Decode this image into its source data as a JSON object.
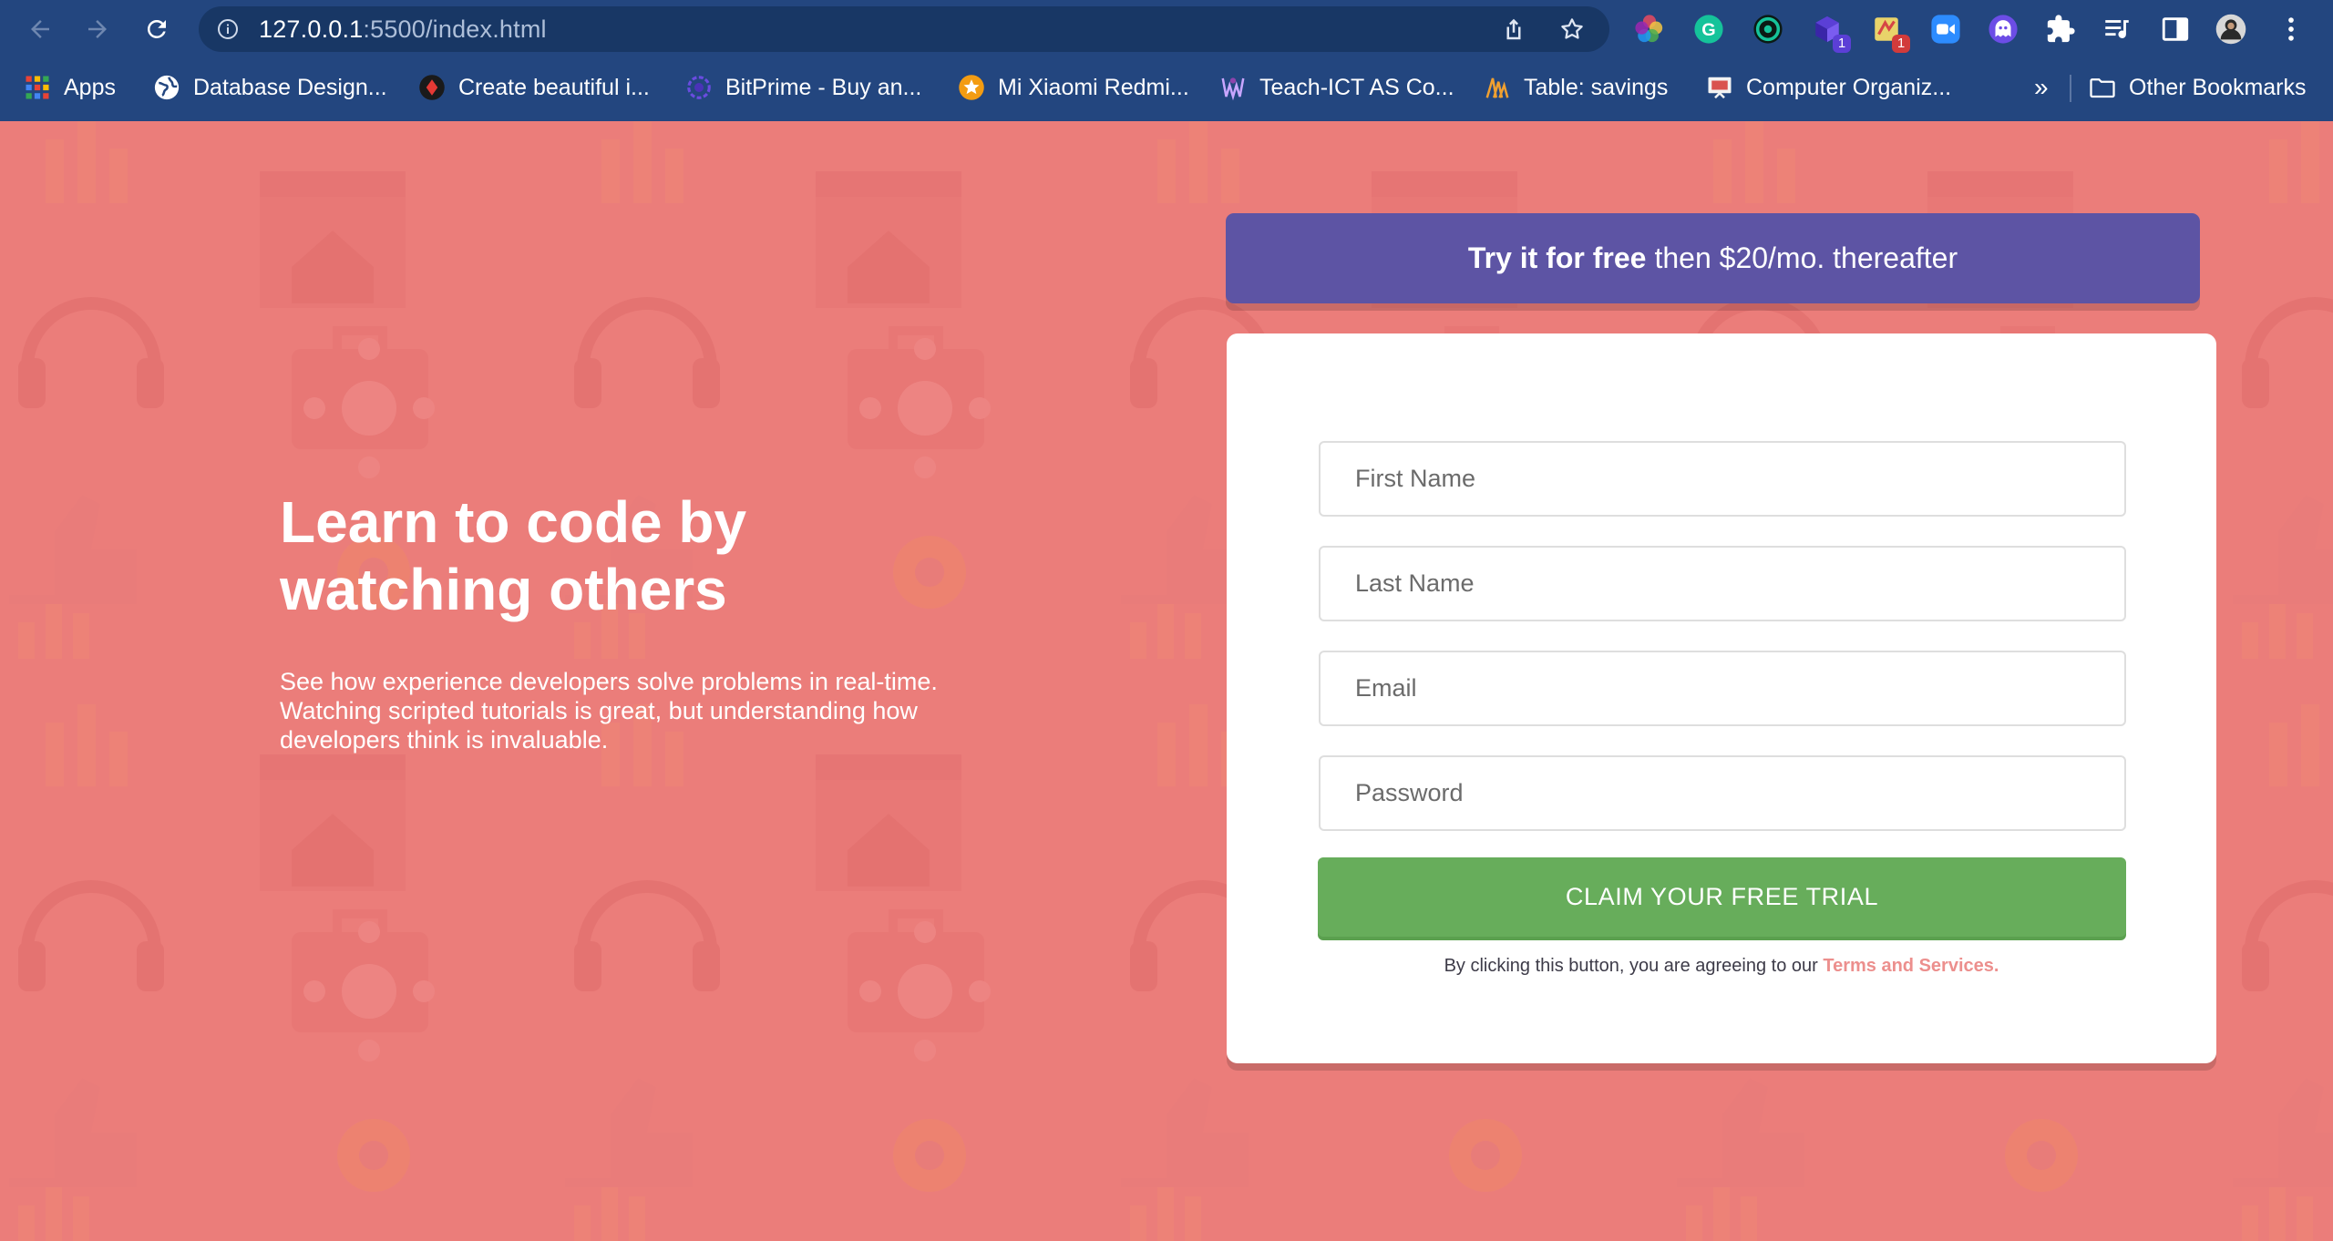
{
  "browser": {
    "url_host": "127.0.0.1",
    "url_rest": ":5500/index.html",
    "nav_icons": [
      "back-icon",
      "forward-icon",
      "reload-icon"
    ],
    "extensions": [
      {
        "name": "color-wheel-extension-icon"
      },
      {
        "name": "grammarly-extension-icon"
      },
      {
        "name": "grammarly-go-extension-icon"
      },
      {
        "name": "stacked-cubes-extension-icon",
        "badge": "1"
      },
      {
        "name": "notes-extension-icon",
        "badge": "1"
      },
      {
        "name": "zoom-extension-icon"
      },
      {
        "name": "ghost-extension-icon"
      },
      {
        "name": "puzzle-extensions-icon"
      },
      {
        "name": "media-queue-icon"
      },
      {
        "name": "side-panel-icon"
      },
      {
        "name": "profile-avatar"
      },
      {
        "name": "kebab-menu-icon"
      }
    ]
  },
  "bookmarks": {
    "items": [
      {
        "label": "Apps",
        "icon": "apps-grid-icon"
      },
      {
        "label": "Database Design...",
        "icon": "globe-icon"
      },
      {
        "label": "Create beautiful i...",
        "icon": "carbon-icon"
      },
      {
        "label": "BitPrime - Buy an...",
        "icon": "bitprime-icon"
      },
      {
        "label": "Mi Xiaomi Redmi...",
        "icon": "star-badge-icon"
      },
      {
        "label": "Teach-ICT AS Co...",
        "icon": "teach-ict-icon"
      },
      {
        "label": "Table: savings",
        "icon": "table-icon"
      },
      {
        "label": "Computer Organiz...",
        "icon": "presentation-icon"
      }
    ],
    "overflow_label": "»",
    "other_label": "Other Bookmarks"
  },
  "hero": {
    "heading": "Learn to code by watching others",
    "description": "See how experience developers solve problems in real-time. Watching scripted tutorials is great, but understanding how developers think is invaluable."
  },
  "trial": {
    "bold": "Try it for free",
    "rest": "then $20/mo. thereafter"
  },
  "form": {
    "first_name_placeholder": "First Name",
    "last_name_placeholder": "Last Name",
    "email_placeholder": "Email",
    "password_placeholder": "Password",
    "submit_label": "CLAIM YOUR FREE TRIAL",
    "terms_prefix": "By clicking this button, you are agreeing to our",
    "terms_link": "Terms and Services."
  },
  "colors": {
    "background": "#ec7d7a",
    "banner": "#5d54a4",
    "button": "#67ad5b",
    "terms_link": "#ec8f8d"
  }
}
